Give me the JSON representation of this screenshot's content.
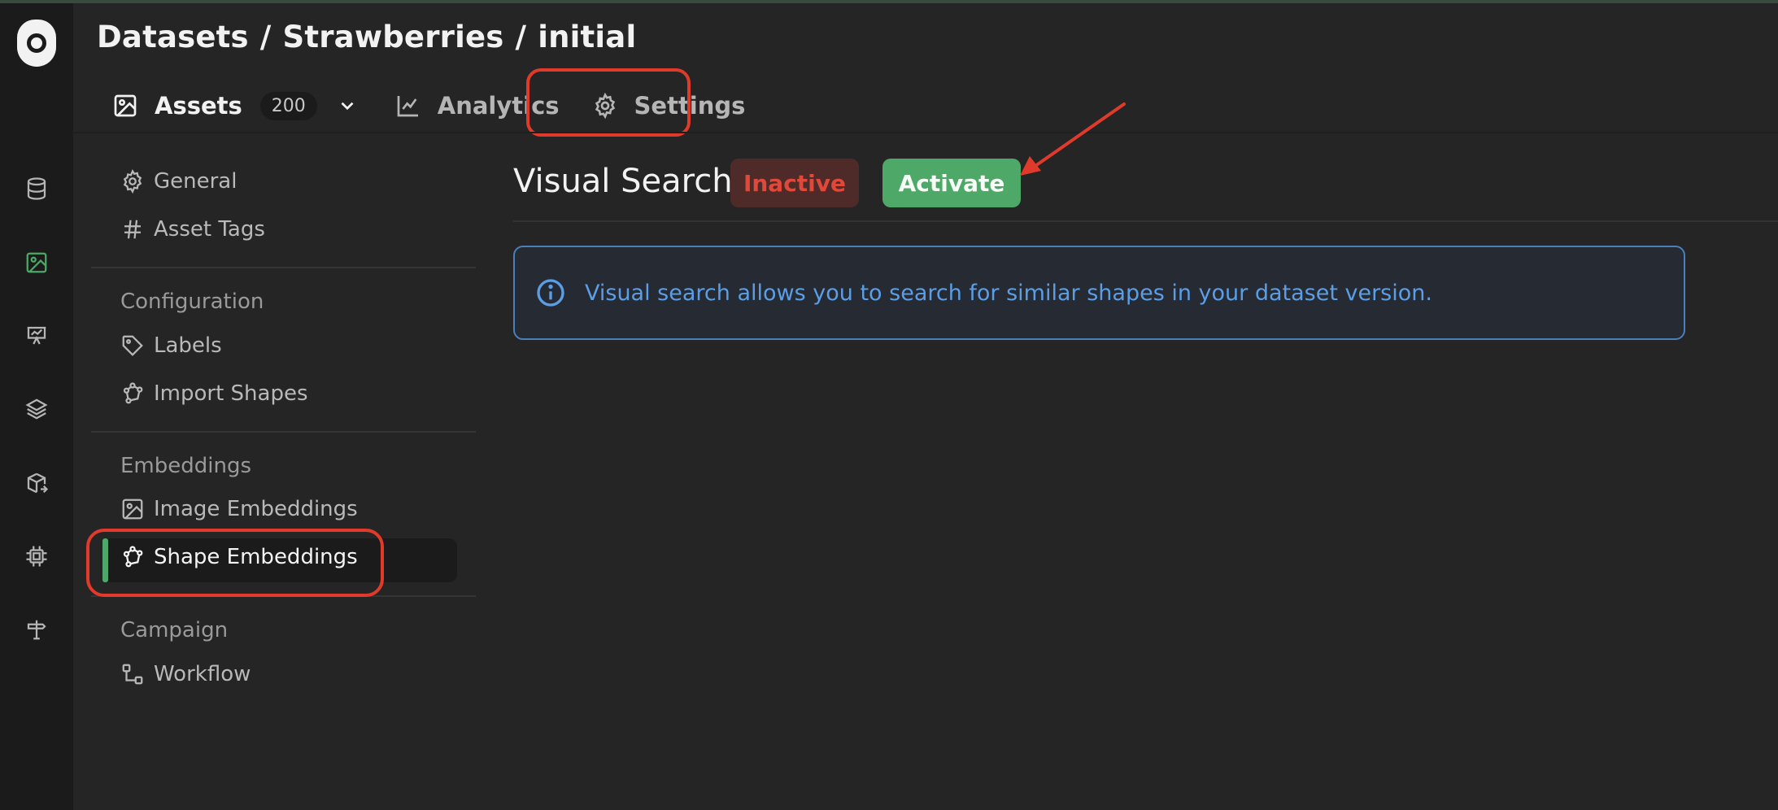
{
  "breadcrumb": {
    "part1": "Datasets",
    "sep1": "/",
    "part2": "Strawberries",
    "sep2": "/",
    "part3": "initial"
  },
  "tabs": {
    "assets": {
      "label": "Assets",
      "count": "200"
    },
    "analytics": {
      "label": "Analytics"
    },
    "settings": {
      "label": "Settings"
    }
  },
  "nav": {
    "general": "General",
    "asset_tags": "Asset Tags",
    "configuration": "Configuration",
    "labels": "Labels",
    "import_shapes": "Import Shapes",
    "embeddings": "Embeddings",
    "image_embeddings": "Image Embeddings",
    "shape_embeddings": "Shape Embeddings",
    "campaign": "Campaign",
    "workflow": "Workflow"
  },
  "main": {
    "title": "Visual Search",
    "status": "Inactive",
    "activate_label": "Activate",
    "info": "Visual search allows you to search for similar shapes in your dataset version."
  },
  "colors": {
    "accent_green": "#4ea868",
    "inactive_red": "#e0483a",
    "info_blue": "#5b9ee6",
    "annotation_red": "#e03a2a"
  }
}
